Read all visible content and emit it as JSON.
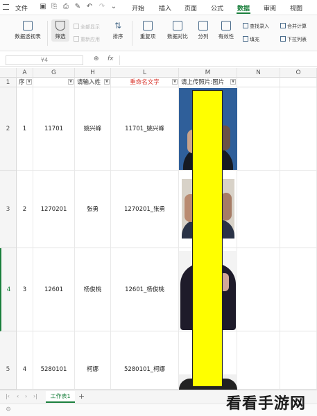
{
  "menu": {
    "file": "文件",
    "tabs": [
      "开始",
      "插入",
      "页面",
      "公式",
      "数据",
      "审阅",
      "视图"
    ],
    "active_tab": "数据"
  },
  "ribbon": {
    "pivot": "数据透视表",
    "filter": "筛选",
    "show_all": "全部显示",
    "reapply": "重新应用",
    "sort": "排序",
    "dedupe": "重复项",
    "compare": "数据对比",
    "split": "分列",
    "validity": "有效性",
    "find_entry": "查找录入",
    "fill": "填充",
    "merge_calc": "合并计算",
    "dropdown_list": "下拉列表"
  },
  "formula_bar": {
    "name_box": "¥4",
    "fx": "fx"
  },
  "columns": [
    "A",
    "G",
    "H",
    "L",
    "M",
    "N",
    "O"
  ],
  "header_row": {
    "row_number": "1",
    "a": "序",
    "g": "",
    "h": "请输入姓",
    "l": "重命名文字",
    "m": "请上传照片:图片"
  },
  "rows": [
    {
      "row_number": "2",
      "seq": "1",
      "id": "11701",
      "name": "姚兴峰",
      "rename": "11701_姚兴峰"
    },
    {
      "row_number": "3",
      "seq": "2",
      "id": "1270201",
      "name": "张勇",
      "rename": "1270201_张勇"
    },
    {
      "row_number": "4",
      "seq": "3",
      "id": "12601",
      "name": "杨俊桃",
      "rename": "12601_杨俊桃"
    },
    {
      "row_number": "5",
      "seq": "4",
      "id": "5280101",
      "name": "柯娜",
      "rename": "5280101_柯娜"
    }
  ],
  "sheet_tab": "工作表1",
  "add_sheet": "+",
  "watermark": "看看手游网",
  "colors": {
    "accent": "#1a7f3c",
    "highlight": "#ffff00",
    "header_red": "#d9342b"
  }
}
